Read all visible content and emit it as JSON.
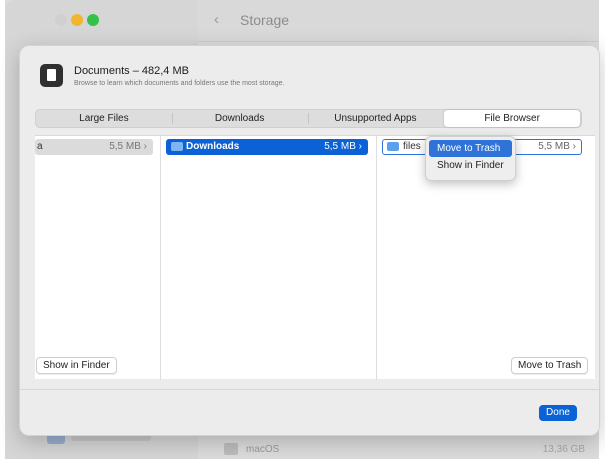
{
  "window": {
    "title": "Storage"
  },
  "background": {
    "disk": {
      "name": "macOS",
      "size": "13,36 GB"
    }
  },
  "sheet": {
    "title": "Documents – 482,4 MB",
    "subtitle": "Browse to learn which documents and folders use the most storage."
  },
  "tabs": [
    {
      "label": "Large Files"
    },
    {
      "label": "Downloads"
    },
    {
      "label": "Unsupported Apps"
    },
    {
      "label": "File Browser",
      "active": true
    }
  ],
  "columns": [
    {
      "items": [
        {
          "name": "a",
          "size": "5,5 MB ›"
        }
      ]
    },
    {
      "items": [
        {
          "name": "Downloads",
          "size": "5,5 MB ›",
          "selected": true
        }
      ]
    },
    {
      "items": [
        {
          "name": "files",
          "size": "5,5 MB ›"
        }
      ]
    }
  ],
  "context_menu": {
    "items": [
      "Move to Trash",
      "Show in Finder"
    ]
  },
  "buttons": {
    "show_in_finder": "Show in Finder",
    "move_to_trash": "Move to Trash",
    "done": "Done"
  },
  "colors": {
    "accent": "#0a62d6",
    "menu_highlight": "#2f73d8"
  }
}
